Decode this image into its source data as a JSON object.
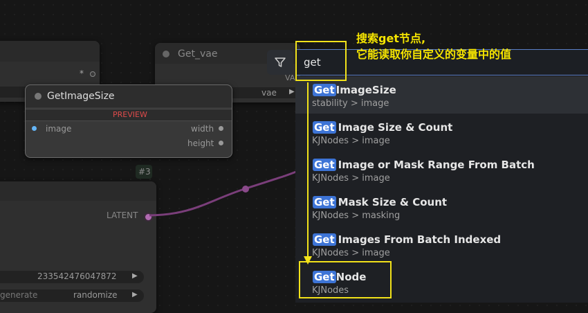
{
  "canvas": {
    "node_left_top": {
      "output_glyph": "*"
    },
    "node_getvae": {
      "title": "Get_vae",
      "output_label": "vae",
      "output_clip": "VA"
    },
    "node_getimagesize": {
      "title": "GetImageSize",
      "preview_label": "PREVIEW",
      "input_label": "image",
      "outputs": [
        "width",
        "height"
      ]
    },
    "node_id_badge": "#3",
    "node_sampler": {
      "output_label": "LATENT",
      "seed_value": "233542476047872",
      "control_label": "generate",
      "control_value": "randomize"
    }
  },
  "search": {
    "query": "get",
    "filter_icon": "filter-icon",
    "results": [
      {
        "match": "Get",
        "rest": "ImageSize",
        "category": "stability > image",
        "selected": true
      },
      {
        "match": "Get",
        "rest": "Image Size & Count",
        "category": "KJNodes > image"
      },
      {
        "match": "Get",
        "rest": "Image or Mask Range From Batch",
        "category": "KJNodes > image"
      },
      {
        "match": "Get",
        "rest": "Mask Size & Count",
        "category": "KJNodes > masking"
      },
      {
        "match": "Get",
        "rest": "Images From Batch Indexed",
        "category": "KJNodes > image"
      },
      {
        "match": "Get",
        "rest": "Node",
        "category": "KJNodes"
      }
    ]
  },
  "annotation": {
    "line1": "搜索get节点,",
    "line2": "它能读取你自定义的变量中的值"
  },
  "colors": {
    "accent_blue": "#3d74d6",
    "annotation_yellow": "#f2e21a",
    "link_purple": "#7a3e7a",
    "preview_red": "#e04b4b"
  }
}
